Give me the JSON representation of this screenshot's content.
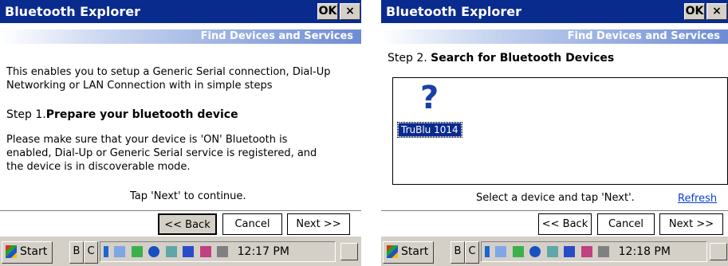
{
  "left_window": {
    "title": "Bluetooth Explorer",
    "ok_label": "OK",
    "close_label": "×",
    "banner": "Find Devices and Services",
    "intro": [
      "This enables you to setup a Generic Serial connection, Dial-Up",
      "Networking or LAN Connection with in simple steps"
    ],
    "step_prefix": "Step 1.",
    "step_title": "Prepare your bluetooth device",
    "details": [
      "Please make sure that your device is 'ON' Bluetooth is",
      "enabled, Dial-Up or Generic Serial service is registered, and",
      "the device is in discoverable mode."
    ],
    "hint": "Tap 'Next' to continue.",
    "back_label": "<< Back",
    "cancel_label": "Cancel",
    "next_label": "Next >>"
  },
  "right_window": {
    "title": "Bluetooth Explorer",
    "ok_label": "OK",
    "close_label": "×",
    "banner": "Find Devices and Services",
    "step_prefix": "Step 2.",
    "step_title": "Search for Bluetooth Devices",
    "device_icon": "?",
    "device_name": "TruBlu 1014",
    "hint": "Select a device and tap 'Next'.",
    "refresh_label": "Refresh",
    "back_label": "<< Back",
    "cancel_label": "Cancel",
    "next_label": "Next >>"
  },
  "taskbar_left": {
    "start_label": "Start",
    "task1": "B",
    "task2": "C",
    "time": "12:17 PM"
  },
  "taskbar_right": {
    "start_label": "Start",
    "task1": "B",
    "task2": "C",
    "time": "12:18 PM"
  }
}
